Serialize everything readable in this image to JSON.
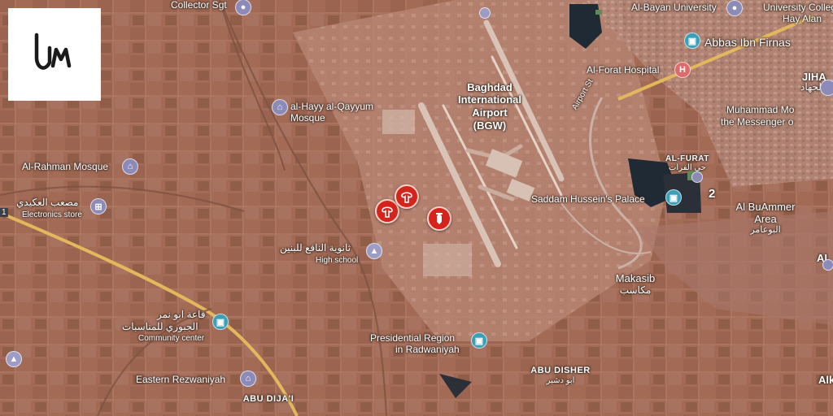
{
  "map": {
    "type": "satellite",
    "logo_text": "LM",
    "labels": {
      "collector_sgt": "Collector Sgt",
      "al_bayan_university": "Al-Bayan University",
      "university_college": "University Colleg",
      "hay_alamel": "Hay Alan",
      "abbas_ibn_firnas": "Abbas Ibn Firnas",
      "al_forat_hospital": "Al-Forat Hospital",
      "jihad": "JIHA",
      "jihad_ar": "الجهاد",
      "airport_line1": "Baghdad",
      "airport_line2": "International",
      "airport_line3": "Airport",
      "airport_line4": "(BGW)",
      "airport_st": "Airport St",
      "muhammad_line1": "Muhammad Mo",
      "muhammad_line2": "the Messenger o",
      "qayyum_line1": "al-Hayy al-Qayyum",
      "qayyum_line2": "Mosque",
      "al_furat": "AL-FURAT",
      "al_furat_ar": "حي الفرات",
      "rahman_mosque": "Al-Rahman Mosque",
      "saddam_palace": "Saddam Hussein's Palace",
      "mosab_ar": "مصعب العكيدي",
      "electronics_store": "Electronics store",
      "albuammer_line1": "Al BuAmmer",
      "albuammer_line2": "Area",
      "albuammer_ar": "البوعامر",
      "school_ar": "ثانوية النافع للبنين",
      "high_school": "High school",
      "makasib": "Makasib",
      "makasib_ar": "مكاسب",
      "al_right": "AL",
      "hall_ar_line1": "قاعة ابو نمر",
      "hall_ar_line2": "الجبوري للمناسبات",
      "community_center": "Community center",
      "presidential_line1": "Presidential Region",
      "presidential_line2": "in Radwaniyah",
      "abu_disher": "ABU DISHER",
      "abu_disher_ar": "ابو دشير",
      "eastern_rezwaniyah": "Eastern Rezwaniyah",
      "abu_dijail": "ABU DIJA'I",
      "alk": "Alk",
      "road_shield": "1"
    },
    "colors": {
      "ground": "#a06a55",
      "strike": "#d4241b",
      "road": "#e3b85c",
      "water": "#1f2a35"
    }
  }
}
